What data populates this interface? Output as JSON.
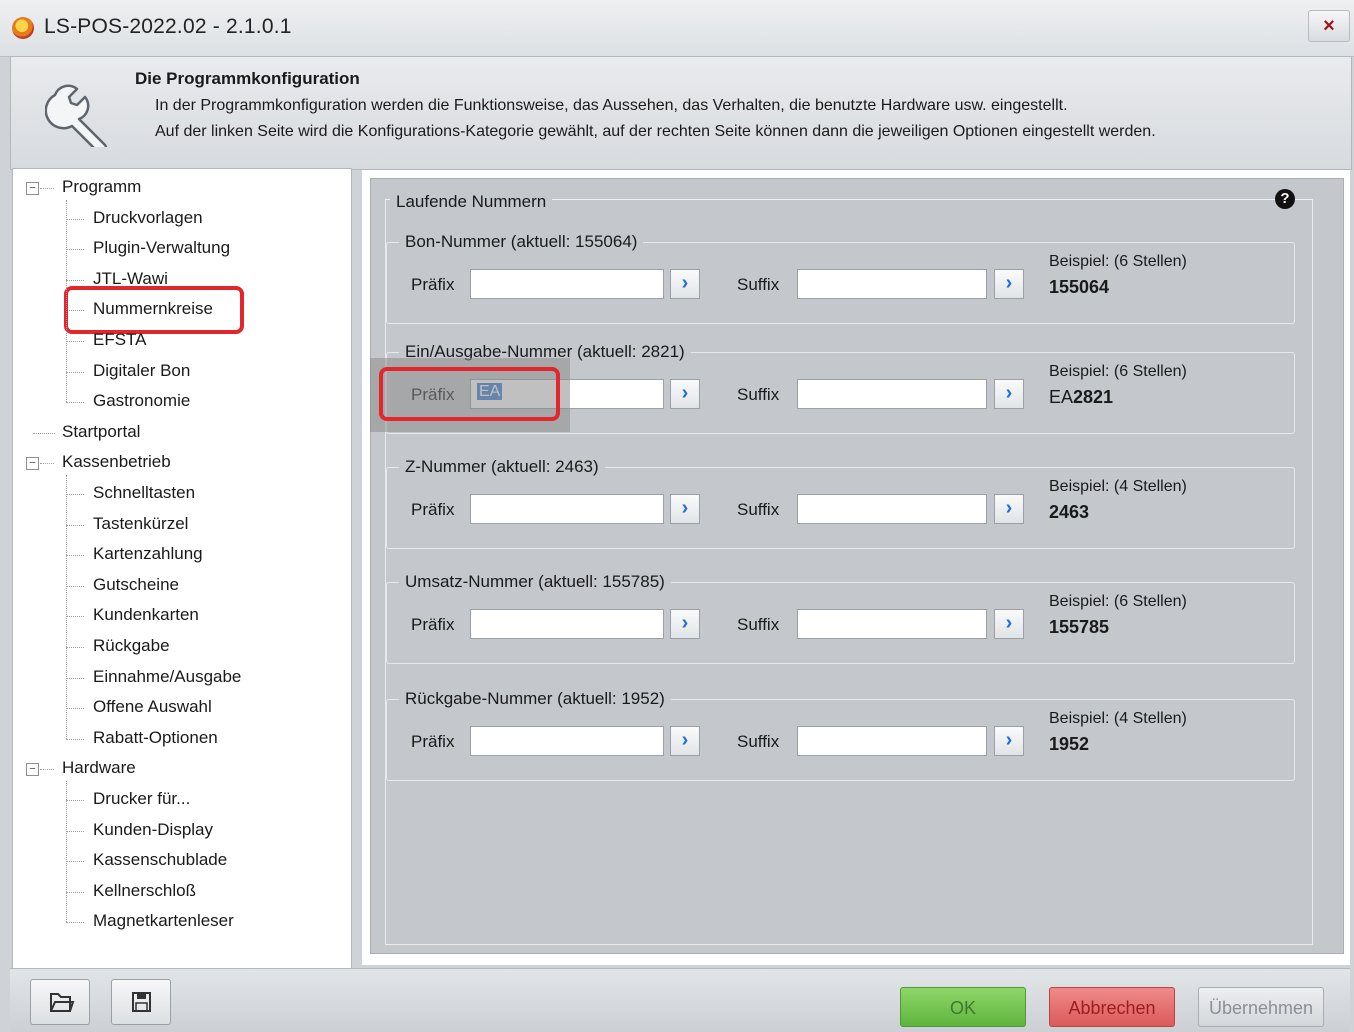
{
  "window": {
    "title": "LS-POS-2022.02 - 2.1.0.1",
    "close_label": "×"
  },
  "header": {
    "title": "Die Programmkonfiguration",
    "line1": "In der Programmkonfiguration werden die Funktionsweise, das Aussehen, das Verhalten, die benutzte Hardware usw. eingestellt.",
    "line2": "Auf der linken Seite wird die Konfigurations-Kategorie gewählt, auf der rechten Seite können dann die jeweiligen Optionen eingestellt werden."
  },
  "tree": {
    "groups": [
      {
        "label": "Programm",
        "toggle": "−",
        "children": [
          "Druckvorlagen",
          "Plugin-Verwaltung",
          "JTL-Wawi",
          "Nummernkreise",
          "EFSTA",
          "Digitaler Bon",
          "Gastronomie"
        ]
      },
      {
        "label": "Startportal"
      },
      {
        "label": "Kassenbetrieb",
        "toggle": "−",
        "children": [
          "Schnelltasten",
          "Tastenkürzel",
          "Kartenzahlung",
          "Gutscheine",
          "Kundenkarten",
          "Rückgabe",
          "Einnahme/Ausgabe",
          "Offene Auswahl",
          "Rabatt-Optionen"
        ]
      },
      {
        "label": "Hardware",
        "toggle": "−",
        "children": [
          "Drucker für...",
          "Kunden-Display",
          "Kassenschublade",
          "Kellnerschloß",
          "Magnetkartenleser"
        ]
      }
    ],
    "selected": "Nummernkreise"
  },
  "content": {
    "section_title": "Laufende Nummern",
    "help_icon": "?",
    "prefix_label": "Präfix",
    "suffix_label": "Suffix",
    "arrow_glyph": "›",
    "groups": [
      {
        "title": "Bon-Nummer  (aktuell: 155064)",
        "prefix": "",
        "suffix": "",
        "example_label": "Beispiel:  (6 Stellen)",
        "example_prefix": "",
        "example_number": "155064"
      },
      {
        "title": "Ein/Ausgabe-Nummer  (aktuell: 2821)",
        "prefix": "EA",
        "suffix": "",
        "example_label": "Beispiel:  (6 Stellen)",
        "example_prefix": "EA",
        "example_number": "2821"
      },
      {
        "title": "Z-Nummer  (aktuell: 2463)",
        "prefix": "",
        "suffix": "",
        "example_label": "Beispiel:  (4 Stellen)",
        "example_prefix": "",
        "example_number": "2463"
      },
      {
        "title": "Umsatz-Nummer  (aktuell: 155785)",
        "prefix": "",
        "suffix": "",
        "example_label": "Beispiel:  (6 Stellen)",
        "example_prefix": "",
        "example_number": "155785"
      },
      {
        "title": "Rückgabe-Nummer  (aktuell: 1952)",
        "prefix": "",
        "suffix": "",
        "example_label": "Beispiel:  (4 Stellen)",
        "example_prefix": "",
        "example_number": "1952"
      }
    ]
  },
  "footer": {
    "ok_label": "OK",
    "cancel_label": "Abbrechen",
    "apply_label": "Übernehmen"
  },
  "colors": {
    "highlight": "#e3262c",
    "ok_green": "#6fc14a",
    "cancel_red": "#e46a6a",
    "arrow_blue": "#1f6fd8"
  }
}
